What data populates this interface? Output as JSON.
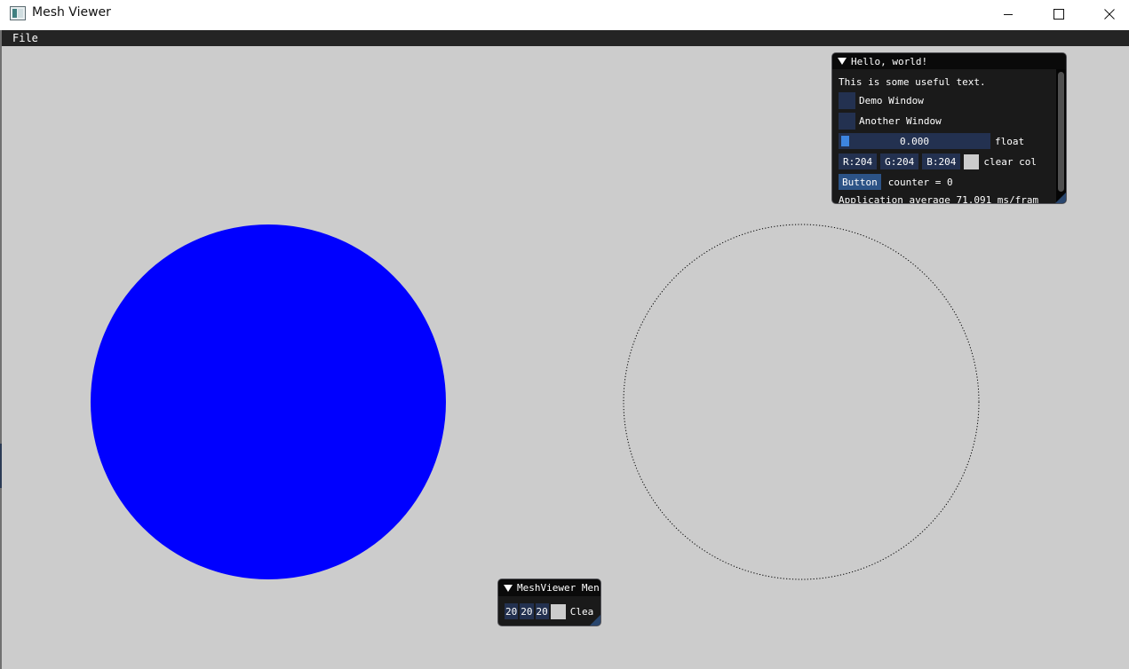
{
  "window": {
    "title": "Mesh Viewer",
    "controls": {
      "minimize_icon": "minimize-icon",
      "maximize_icon": "maximize-icon",
      "close_icon": "close-icon"
    }
  },
  "menubar": {
    "file_label": "File"
  },
  "canvas": {
    "background_color": "#cccccc",
    "shapes": [
      {
        "type": "filled-circle",
        "color": "#0000ff"
      },
      {
        "type": "dotted-circle-outline",
        "color": "#000000"
      }
    ]
  },
  "hello_window": {
    "title": "Hello, world!",
    "text": "This is some useful text.",
    "demo_checkbox_label": "Demo Window",
    "another_checkbox_label": "Another Window",
    "slider_value": "0.000",
    "slider_label": "float",
    "color_r": "R:204",
    "color_g": "G:204",
    "color_b": "B:204",
    "color_label": "clear col",
    "button_label": "Button",
    "counter_text": "counter = 0",
    "average_text": "Application average 71.091 ms/fram"
  },
  "meshviewer_window": {
    "title": "MeshViewer Men",
    "r_value": "20",
    "g_value": "20",
    "b_value": "20",
    "color_label": "Clea"
  },
  "colors": {
    "title_bar_bg": "#ffffff",
    "menubar_bg": "#242424",
    "imgui_frame": "#233150",
    "imgui_button": "#2c5386",
    "slider_grab": "#3d85e0"
  }
}
